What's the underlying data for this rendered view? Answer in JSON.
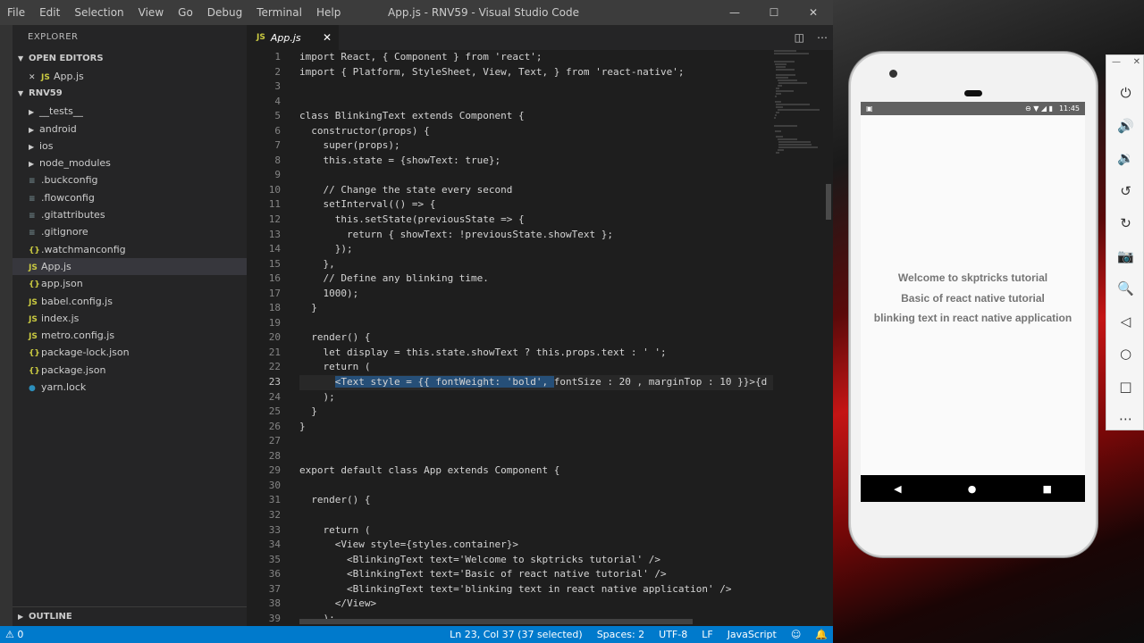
{
  "vscode": {
    "menu": [
      "File",
      "Edit",
      "Selection",
      "View",
      "Go",
      "Debug",
      "Terminal",
      "Help"
    ],
    "window_title": "App.js - RNV59 - Visual Studio Code",
    "sidebar": {
      "header": "EXPLORER",
      "open_editors_label": "OPEN EDITORS",
      "open_editor_file": "App.js",
      "project_label": "RNV59",
      "items": [
        {
          "label": "__tests__",
          "kind": "folder"
        },
        {
          "label": "android",
          "kind": "folder"
        },
        {
          "label": "ios",
          "kind": "folder"
        },
        {
          "label": "node_modules",
          "kind": "folder"
        },
        {
          "label": ".buckconfig",
          "kind": "cfg"
        },
        {
          "label": ".flowconfig",
          "kind": "cfg"
        },
        {
          "label": ".gitattributes",
          "kind": "cfg"
        },
        {
          "label": ".gitignore",
          "kind": "cfg"
        },
        {
          "label": ".watchmanconfig",
          "kind": "json"
        },
        {
          "label": "App.js",
          "kind": "js"
        },
        {
          "label": "app.json",
          "kind": "json"
        },
        {
          "label": "babel.config.js",
          "kind": "js"
        },
        {
          "label": "index.js",
          "kind": "js"
        },
        {
          "label": "metro.config.js",
          "kind": "js"
        },
        {
          "label": "package-lock.json",
          "kind": "json"
        },
        {
          "label": "package.json",
          "kind": "json"
        },
        {
          "label": "yarn.lock",
          "kind": "yarn"
        }
      ],
      "outline_label": "OUTLINE"
    },
    "tab": {
      "label": "App.js",
      "icon_text": "JS"
    },
    "editor": {
      "line_numbers": [
        "1",
        "2",
        "3",
        "4",
        "5",
        "6",
        "7",
        "8",
        "9",
        "10",
        "11",
        "12",
        "13",
        "14",
        "15",
        "16",
        "17",
        "18",
        "19",
        "20",
        "21",
        "22",
        "23",
        "24",
        "25",
        "26",
        "27",
        "28",
        "29",
        "30",
        "31",
        "32",
        "33",
        "34",
        "35",
        "36",
        "37",
        "38",
        "39"
      ],
      "lines": [
        "import React, { Component } from 'react';",
        "import { Platform, StyleSheet, View, Text, } from 'react-native';",
        "",
        "",
        "class BlinkingText extends Component {",
        "  constructor(props) {",
        "    super(props);",
        "    this.state = {showText: true};",
        "",
        "    // Change the state every second",
        "    setInterval(() => {",
        "      this.setState(previousState => {",
        "        return { showText: !previousState.showText };",
        "      });",
        "    },",
        "    // Define any blinking time.",
        "    1000);",
        "  }",
        "",
        "  render() {",
        "    let display = this.state.showText ? this.props.text : ' ';",
        "    return (",
        "      <Text style = {{ fontWeight: 'bold', fontSize : 20 , marginTop : 10 }}>{d",
        "    );",
        "  }",
        "}",
        "",
        "",
        "export default class App extends Component {",
        "",
        "  render() {",
        "",
        "    return (",
        "      <View style={styles.container}>",
        "        <BlinkingText text='Welcome to skptricks tutorial' />",
        "        <BlinkingText text='Basic of react native tutorial' />",
        "        <BlinkingText text='blinking text in react native application' />",
        "      </View>",
        "    );"
      ],
      "current_line": 23
    },
    "statusbar": {
      "problems": "⚠ 0",
      "cursor": "Ln 23, Col 37 (37 selected)",
      "spaces": "Spaces: 2",
      "encoding": "UTF-8",
      "eol": "LF",
      "language": "JavaScript"
    },
    "colors": {
      "accent": "#007acc",
      "titlebar": "#3c3c3c",
      "sidebar": "#252526",
      "editor_bg": "#1e1e1e"
    }
  },
  "emulator": {
    "status_time": "11:45",
    "texts": [
      "Welcome to skptricks tutorial",
      "Basic of react native tutorial",
      "blinking text in react native application"
    ],
    "tools": [
      "power-icon",
      "volume-up-icon",
      "volume-down-icon",
      "rotate-left-icon",
      "rotate-right-icon",
      "camera-icon",
      "zoom-icon",
      "back-icon",
      "home-icon",
      "overview-icon",
      "more-icon"
    ]
  }
}
